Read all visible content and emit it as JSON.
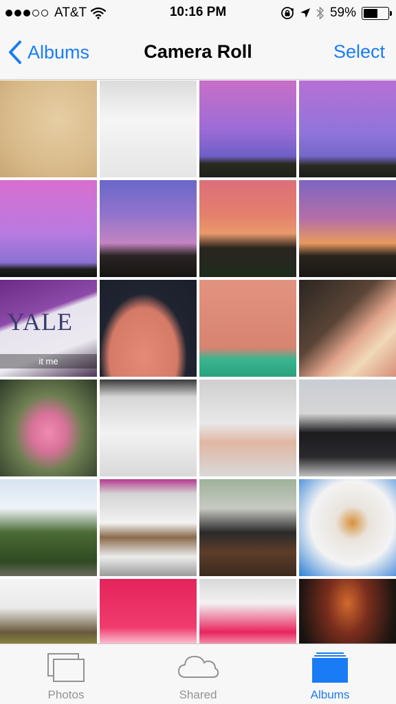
{
  "status_bar": {
    "carrier": "AT&T",
    "signal_bars": 3,
    "signal_total": 5,
    "time": "10:16 PM",
    "battery_percent_label": "59%",
    "battery_level": 0.59
  },
  "nav": {
    "back_label": "Albums",
    "title": "Camera Roll",
    "select_label": "Select"
  },
  "grid": {
    "overlay_yale_text": "YALE",
    "overlay_caption": "it me"
  },
  "tab_bar": {
    "tabs": [
      {
        "label": "Photos",
        "icon": "photos-icon",
        "active": false
      },
      {
        "label": "Shared",
        "icon": "cloud-icon",
        "active": false
      },
      {
        "label": "Albums",
        "icon": "albums-icon",
        "active": true
      }
    ]
  },
  "colors": {
    "accent": "#1a7cf4",
    "inactive": "#929292",
    "bar_background": "#f7f7f7"
  }
}
